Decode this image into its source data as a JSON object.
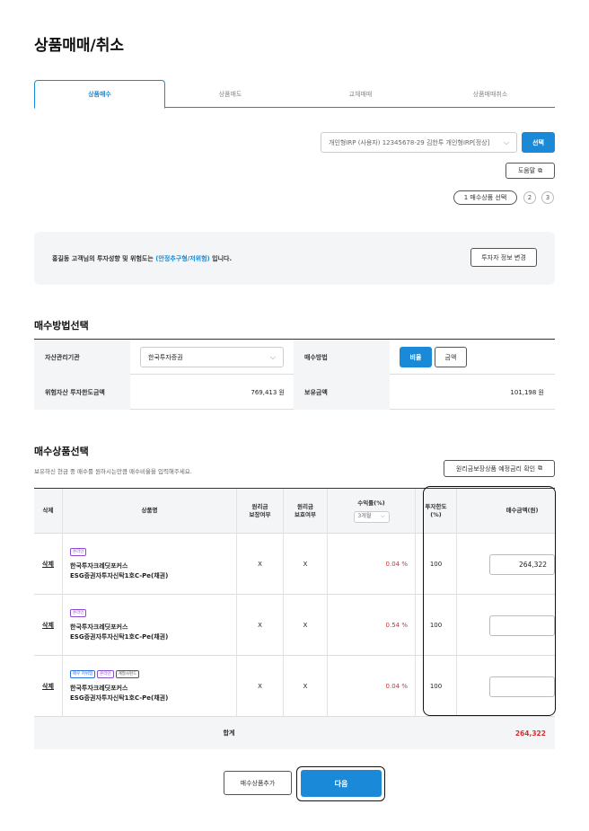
{
  "page": {
    "title": "상품매매/취소"
  },
  "tabs": [
    {
      "label": "상품매수",
      "active": true
    },
    {
      "label": "상품매도",
      "active": false
    },
    {
      "label": "교체매매",
      "active": false
    },
    {
      "label": "상품매매취소",
      "active": false
    }
  ],
  "account": {
    "selected": "개인형IRP (사용자) 12345678-29 김한투 개인형IRP[정상]",
    "select_button": "선택"
  },
  "help_button": "도움말",
  "steps": {
    "current_label": "1 매수상품 선택",
    "step2": "2",
    "step3": "3"
  },
  "notice": {
    "prefix": "홍길동 고객님의 투자성향 및 위험도는 ",
    "highlight": "(안정추구형/저위험)",
    "suffix": " 입니다.",
    "change_button": "투자자 정보 변경"
  },
  "method": {
    "title": "매수방법선택",
    "asset_manager_label": "자산관리기관",
    "asset_manager_value": "한국투자증권",
    "buy_method_label": "매수방법",
    "ratio_button": "비율",
    "amount_button": "금액",
    "risk_limit_label": "위험자산 투자한도금액",
    "risk_limit_value": "769,413 원",
    "holding_label": "보유금액",
    "holding_value": "101,198 원"
  },
  "products": {
    "title": "매수상품선택",
    "hint": "보유하신 현금 중 매수를 원하시는만큼 매수비율을 입력해주세요.",
    "guarantee_button": "원리금보장상품 예정금리 확인",
    "headers": {
      "delete": "삭제",
      "name": "상품명",
      "guarantee": "원리금\n보장여부",
      "protect": "원리금\n보호여부",
      "return": "수익률(%)",
      "period": "3개월",
      "limit": "투자한도\n(%)",
      "amount": "매수금액(원)"
    },
    "rows": [
      {
        "delete": "삭제",
        "tags": [
          "온라인"
        ],
        "name_line1": "한국투자크레딧포커스",
        "name_line2": "ESG증권자투자신탁1호C-Pe(채권)",
        "guarantee": "X",
        "protect": "X",
        "return": "0.04 %",
        "limit": "100",
        "amount": "264,322"
      },
      {
        "delete": "삭제",
        "tags": [
          "온라인"
        ],
        "name_line1": "한국투자크레딧포커스",
        "name_line2": "ESG증권자투자신탁1호C-Pe(채권)",
        "guarantee": "X",
        "protect": "X",
        "return": "0.54 %",
        "limit": "100",
        "amount": ""
      },
      {
        "delete": "삭제",
        "tags": [
          "매우 저위험",
          "온라인",
          "계열사펀드"
        ],
        "name_line1": "한국투자크레딧포커스",
        "name_line2": "ESG증권자투자신탁1호C-Pe(채권)",
        "guarantee": "X",
        "protect": "X",
        "return": "0.04 %",
        "limit": "100",
        "amount": ""
      }
    ],
    "total_label": "합계",
    "total_value": "264,322"
  },
  "footer": {
    "add_button": "매수상품추가",
    "next_button": "다음"
  },
  "colors": {
    "accent": "#1a8ad8",
    "negative": "#d62f2f"
  }
}
